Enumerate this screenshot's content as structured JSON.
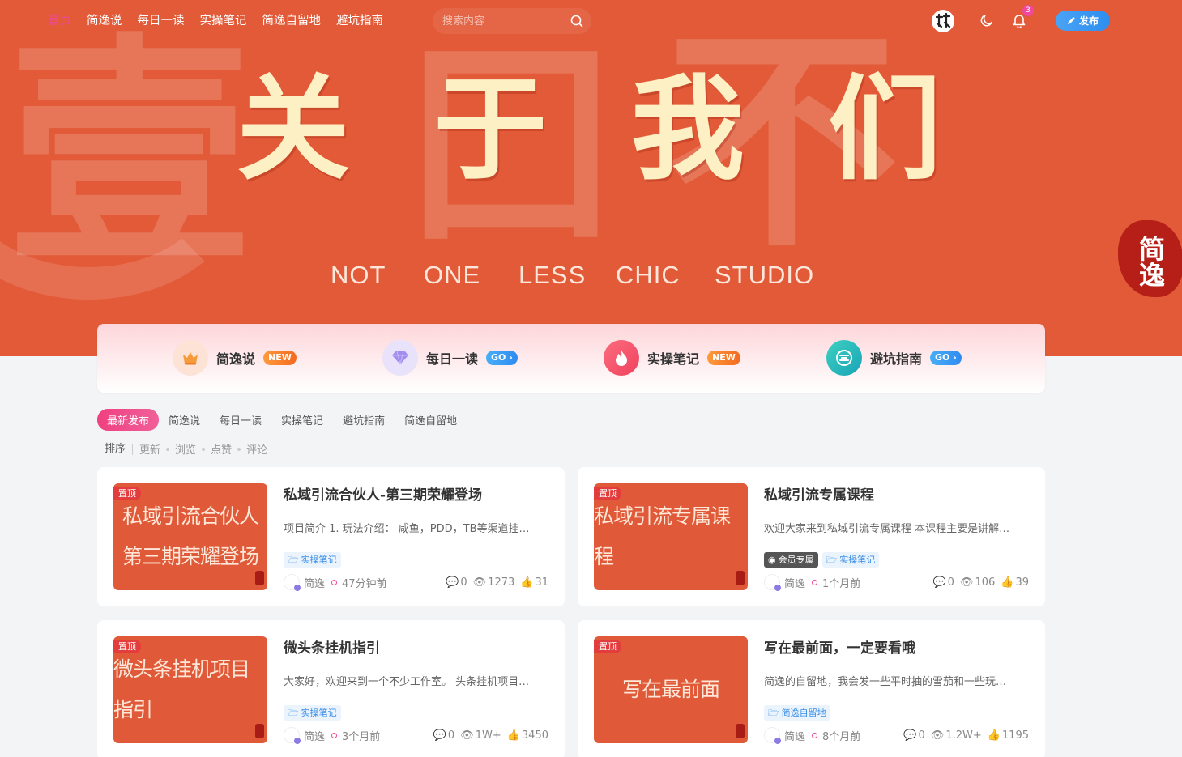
{
  "nav": {
    "items": [
      "首页",
      "简逸说",
      "每日一读",
      "实操笔记",
      "简逸自留地",
      "避坑指南"
    ],
    "active": 0
  },
  "search": {
    "placeholder": "搜索内容"
  },
  "header": {
    "notification_count": "3",
    "publish_label": "发布"
  },
  "hero": {
    "title_chars": [
      "关",
      "于",
      "我",
      "们"
    ],
    "subtitle_words": [
      "NOT",
      "ONE",
      "LESS",
      "CHIC",
      "STUDIO"
    ],
    "seal_text": "简逸"
  },
  "quick_nav": [
    {
      "label": "简逸说",
      "tag": "NEW",
      "icon": "crown-icon"
    },
    {
      "label": "每日一读",
      "tag": "GO",
      "icon": "diamond-icon"
    },
    {
      "label": "实操笔记",
      "tag": "NEW",
      "icon": "flame-icon"
    },
    {
      "label": "避坑指南",
      "tag": "GO",
      "icon": "coin-icon"
    }
  ],
  "tabs": [
    "最新发布",
    "简逸说",
    "每日一读",
    "实操笔记",
    "避坑指南",
    "简逸自留地"
  ],
  "sort": {
    "label": "排序",
    "options": [
      "更新",
      "浏览",
      "点赞",
      "评论"
    ]
  },
  "posts": [
    {
      "thumb_lines": [
        "私域引流合伙人",
        "第三期荣耀登场"
      ],
      "pin": "置顶",
      "title": "私域引流合伙人-第三期荣耀登场",
      "desc": "项目简介 1. 玩法介绍： 咸鱼，PDD，TB等渠道挂…",
      "tags": [
        {
          "label": "实操笔记",
          "vip": false
        }
      ],
      "author": "简逸",
      "time": "47分钟前",
      "comments": "0",
      "views": "1273",
      "likes": "31"
    },
    {
      "thumb_lines": [
        "私域引流专属课程"
      ],
      "pin": "置顶",
      "title": "私域引流专属课程",
      "desc": "欢迎大家来到私域引流专属课程 本课程主要是讲解…",
      "tags": [
        {
          "label": "会员专属",
          "vip": true
        },
        {
          "label": "实操笔记",
          "vip": false
        }
      ],
      "author": "简逸",
      "time": "1个月前",
      "comments": "0",
      "views": "106",
      "likes": "39"
    },
    {
      "thumb_lines": [
        "微头条挂机项目指引"
      ],
      "pin": "置顶",
      "title": "微头条挂机指引",
      "desc": "大家好，欢迎来到一个不少工作室。 头条挂机项目…",
      "tags": [
        {
          "label": "实操笔记",
          "vip": false
        }
      ],
      "author": "简逸",
      "time": "3个月前",
      "comments": "0",
      "views": "1W+",
      "likes": "3450"
    },
    {
      "thumb_lines": [
        "写在最前面"
      ],
      "pin": "置顶",
      "title": "写在最前面，一定要看哦",
      "desc": "简逸的自留地，我会发一些平时抽的雪茄和一些玩…",
      "tags": [
        {
          "label": "简逸自留地",
          "vip": false
        }
      ],
      "author": "简逸",
      "time": "8个月前",
      "comments": "0",
      "views": "1.2W+",
      "likes": "1195"
    }
  ]
}
